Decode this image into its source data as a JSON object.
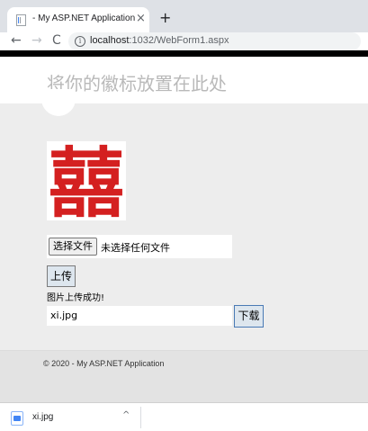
{
  "browser": {
    "tab_title": "- My ASP.NET Application",
    "tab_close": "×",
    "new_tab": "+",
    "back": "←",
    "forward": "→",
    "reload": "C",
    "url_host": "localhost",
    "url_rest": ":1032/WebForm1.aspx",
    "info_icon": "i"
  },
  "header": {
    "site_title": "将你的徽标放置在此处"
  },
  "image": {
    "character": "囍",
    "color": "#d42020"
  },
  "form": {
    "choose_file_label": "选择文件",
    "no_file_text": "未选择任何文件",
    "upload_label": "上传",
    "upload_message": "图片上传成功!",
    "filename_value": "xi.jpg",
    "download_label": "下载"
  },
  "footer": {
    "text": "© 2020 - My ASP.NET Application"
  },
  "download_shelf": {
    "file_name": "xi.jpg",
    "chevron": "^"
  }
}
